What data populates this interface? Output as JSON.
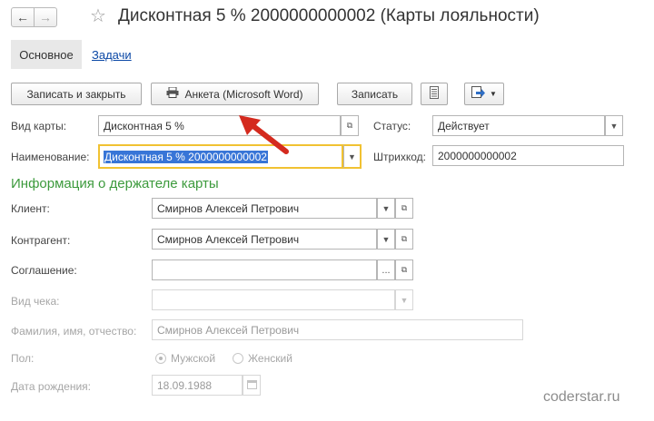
{
  "window": {
    "title": "Дисконтная 5 % 2000000000002 (Карты лояльности)"
  },
  "icons": {
    "back": "arrow-left-icon",
    "forward": "arrow-right-icon",
    "favorite": "star-icon"
  },
  "tabs": [
    {
      "label": "Основное",
      "active": true
    },
    {
      "label": "Задачи",
      "active": false
    }
  ],
  "toolbar": {
    "save_close_label": "Записать и закрыть",
    "form_label": "Анкета (Microsoft Word)",
    "save_label": "Записать"
  },
  "form": {
    "card_type": {
      "label": "Вид карты:",
      "value": "Дисконтная 5 %"
    },
    "status": {
      "label": "Статус:",
      "value": "Действует"
    },
    "name": {
      "label": "Наименование:",
      "value": "Дисконтная 5 % 2000000000002"
    },
    "barcode": {
      "label": "Штрихкод:",
      "value": "2000000000002"
    },
    "holder_section": "Информация о держателе карты",
    "client": {
      "label": "Клиент:",
      "value": "Смирнов Алексей Петрович"
    },
    "counterparty": {
      "label": "Контрагент:",
      "value": "Смирнов Алексей Петрович"
    },
    "agreement": {
      "label": "Соглашение:",
      "value": ""
    },
    "receipt_type": {
      "label": "Вид чека:",
      "value": ""
    },
    "full_name": {
      "label": "Фамилия, имя, отчество:",
      "value": "Смирнов Алексей Петрович"
    },
    "gender": {
      "label": "Пол:",
      "options": [
        "Мужской",
        "Женский"
      ],
      "selected": "Мужской"
    },
    "birth_date": {
      "label": "Дата рождения:",
      "value": "18.09.1988"
    }
  },
  "watermark": "coderstar.ru",
  "colors": {
    "accent_arrow": "#d42a1e",
    "section_title": "#3c9a3c",
    "focus_border": "#f1c232",
    "selection": "#3875d7"
  }
}
